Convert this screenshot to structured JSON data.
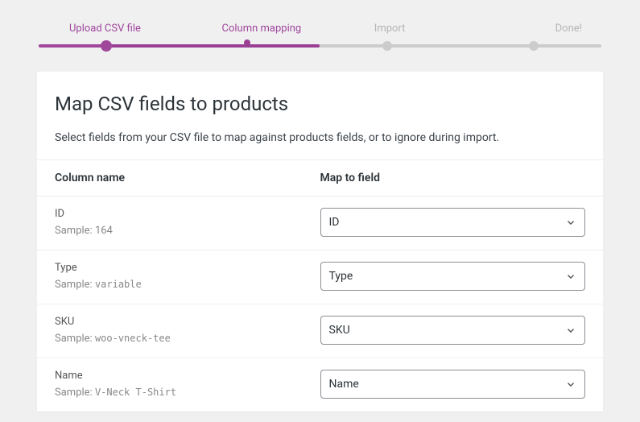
{
  "stepper": {
    "steps": [
      {
        "label": "Upload CSV file",
        "state": "done"
      },
      {
        "label": "Column mapping",
        "state": "current"
      },
      {
        "label": "Import",
        "state": "todo"
      },
      {
        "label": "Done!",
        "state": "todo"
      }
    ]
  },
  "header": {
    "title": "Map CSV fields to products",
    "subtitle": "Select fields from your CSV file to map against products fields, or to ignore during import."
  },
  "table": {
    "col_header": "Column name",
    "map_header": "Map to field",
    "sample_prefix": "Sample:",
    "rows": [
      {
        "name": "ID",
        "sample": "164",
        "sample_mono": false,
        "map": "ID"
      },
      {
        "name": "Type",
        "sample": "variable",
        "sample_mono": true,
        "map": "Type"
      },
      {
        "name": "SKU",
        "sample": "woo-vneck-tee",
        "sample_mono": true,
        "map": "SKU"
      },
      {
        "name": "Name",
        "sample": "V-Neck T-Shirt",
        "sample_mono": true,
        "map": "Name"
      }
    ]
  }
}
